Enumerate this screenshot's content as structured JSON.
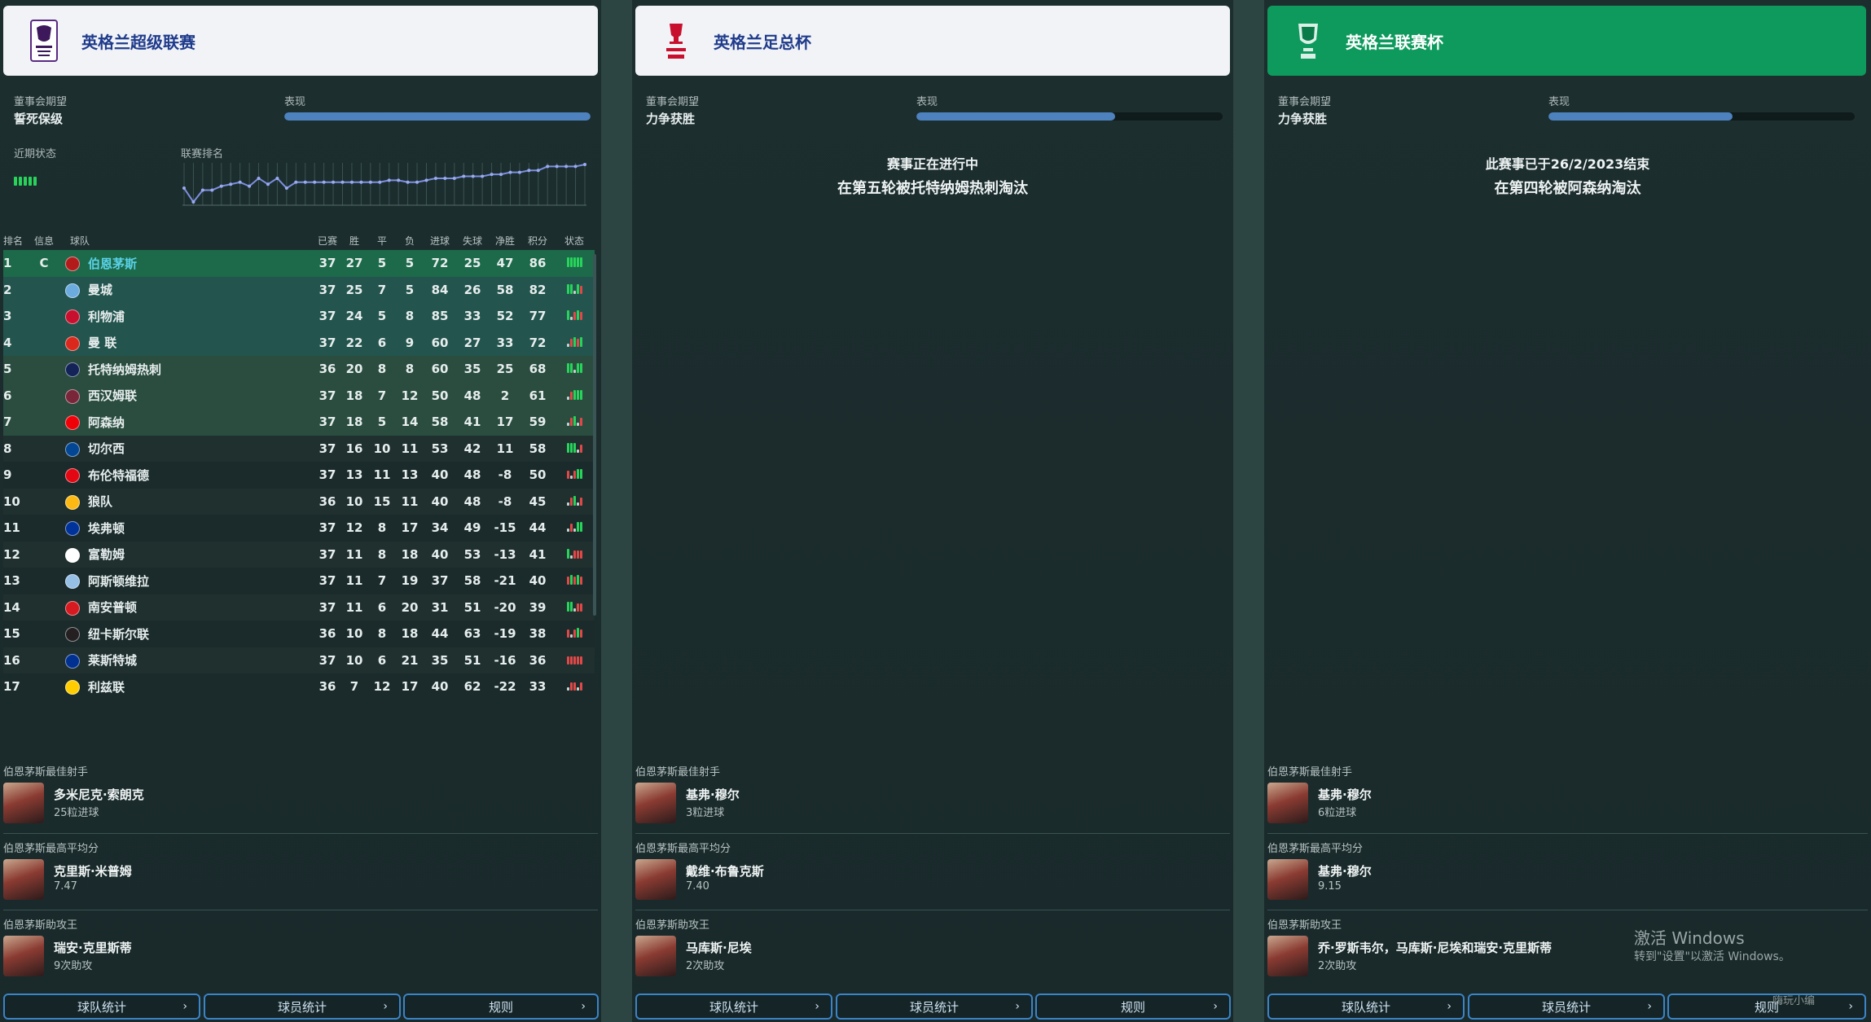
{
  "panels": [
    {
      "title": "英格兰超级联赛",
      "board_label": "董事会期望",
      "board_value": "誓死保级",
      "perf_label": "表现",
      "perf_fill": 1.0,
      "recent_label": "近期状态",
      "rank_label": "联赛排名"
    },
    {
      "title": "英格兰足总杯",
      "board_label": "董事会期望",
      "board_value": "力争获胜",
      "perf_label": "表现",
      "perf_fill": 0.65,
      "status_line1": "赛事正在进行中",
      "status_line2": "在第五轮被托特纳姆热刺淘汰"
    },
    {
      "title": "英格兰联赛杯",
      "board_label": "董事会期望",
      "board_value": "力争获胜",
      "perf_label": "表现",
      "perf_fill": 0.6,
      "status_line1": "此赛事已于26/2/2023结束",
      "status_line2": "在第四轮被阿森纳淘汰"
    }
  ],
  "table_headers": [
    "排名",
    "信息",
    "球队",
    "已赛",
    "胜",
    "平",
    "负",
    "进球",
    "失球",
    "净胜",
    "积分",
    "状态"
  ],
  "rows": [
    {
      "pos": "1",
      "info": "C",
      "team": "伯恩茅斯",
      "p": "37",
      "w": "27",
      "d": "5",
      "l": "5",
      "gf": "72",
      "ga": "25",
      "gd": "47",
      "pts": "86",
      "crest": "#b31b1b",
      "form": "WWWWW"
    },
    {
      "pos": "2",
      "info": "",
      "team": "曼城",
      "p": "37",
      "w": "25",
      "d": "7",
      "l": "5",
      "gf": "84",
      "ga": "26",
      "gd": "58",
      "pts": "82",
      "crest": "#6cabdd",
      "form": "WWDWL"
    },
    {
      "pos": "3",
      "info": "",
      "team": "利物浦",
      "p": "37",
      "w": "24",
      "d": "5",
      "l": "8",
      "gf": "85",
      "ga": "33",
      "gd": "52",
      "pts": "77",
      "crest": "#c8102e",
      "form": "WDLWL"
    },
    {
      "pos": "4",
      "info": "",
      "team": "曼 联",
      "p": "37",
      "w": "22",
      "d": "6",
      "l": "9",
      "gf": "60",
      "ga": "27",
      "gd": "33",
      "pts": "72",
      "crest": "#da291c",
      "form": "DLWLW"
    },
    {
      "pos": "5",
      "info": "",
      "team": "托特纳姆热刺",
      "p": "36",
      "w": "20",
      "d": "8",
      "l": "8",
      "gf": "60",
      "ga": "35",
      "gd": "25",
      "pts": "68",
      "crest": "#132257",
      "form": "WWDWW"
    },
    {
      "pos": "6",
      "info": "",
      "team": "西汉姆联",
      "p": "37",
      "w": "18",
      "d": "7",
      "l": "12",
      "gf": "50",
      "ga": "48",
      "gd": "2",
      "pts": "61",
      "crest": "#7a263a",
      "form": "DLWWW"
    },
    {
      "pos": "7",
      "info": "",
      "team": "阿森纳",
      "p": "37",
      "w": "18",
      "d": "5",
      "l": "14",
      "gf": "58",
      "ga": "41",
      "gd": "17",
      "pts": "59",
      "crest": "#ef0107",
      "form": "DLWDL"
    },
    {
      "pos": "8",
      "info": "",
      "team": "切尔西",
      "p": "37",
      "w": "16",
      "d": "10",
      "l": "11",
      "gf": "53",
      "ga": "42",
      "gd": "11",
      "pts": "58",
      "crest": "#034694",
      "form": "WWWDL"
    },
    {
      "pos": "9",
      "info": "",
      "team": "布伦特福德",
      "p": "37",
      "w": "13",
      "d": "11",
      "l": "13",
      "gf": "40",
      "ga": "48",
      "gd": "-8",
      "pts": "50",
      "crest": "#e30613",
      "form": "LDLWW"
    },
    {
      "pos": "10",
      "info": "",
      "team": "狼队",
      "p": "36",
      "w": "10",
      "d": "15",
      "l": "11",
      "gf": "40",
      "ga": "48",
      "gd": "-8",
      "pts": "45",
      "crest": "#fdb913",
      "form": "DLWDL"
    },
    {
      "pos": "11",
      "info": "",
      "team": "埃弗顿",
      "p": "37",
      "w": "12",
      "d": "8",
      "l": "17",
      "gf": "34",
      "ga": "49",
      "gd": "-15",
      "pts": "44",
      "crest": "#003399",
      "form": "DLDWW"
    },
    {
      "pos": "12",
      "info": "",
      "team": "富勒姆",
      "p": "37",
      "w": "11",
      "d": "8",
      "l": "18",
      "gf": "40",
      "ga": "53",
      "gd": "-13",
      "pts": "41",
      "crest": "#ffffff",
      "form": "WDLLL"
    },
    {
      "pos": "13",
      "info": "",
      "team": "阿斯顿维拉",
      "p": "37",
      "w": "11",
      "d": "7",
      "l": "19",
      "gf": "37",
      "ga": "58",
      "gd": "-21",
      "pts": "40",
      "crest": "#95bfe5",
      "form": "LWLWL"
    },
    {
      "pos": "14",
      "info": "",
      "team": "南安普顿",
      "p": "37",
      "w": "11",
      "d": "6",
      "l": "20",
      "gf": "31",
      "ga": "51",
      "gd": "-20",
      "pts": "39",
      "crest": "#d71920",
      "form": "WWDLL"
    },
    {
      "pos": "15",
      "info": "",
      "team": "纽卡斯尔联",
      "p": "36",
      "w": "10",
      "d": "8",
      "l": "18",
      "gf": "44",
      "ga": "63",
      "gd": "-19",
      "pts": "38",
      "crest": "#241f20",
      "form": "LDLWL"
    },
    {
      "pos": "16",
      "info": "",
      "team": "莱斯特城",
      "p": "37",
      "w": "10",
      "d": "6",
      "l": "21",
      "gf": "35",
      "ga": "51",
      "gd": "-16",
      "pts": "36",
      "crest": "#003090",
      "form": "LLLLL"
    },
    {
      "pos": "17",
      "info": "",
      "team": "利兹联",
      "p": "36",
      "w": "7",
      "d": "12",
      "l": "17",
      "gf": "40",
      "ga": "62",
      "gd": "-22",
      "pts": "33",
      "crest": "#ffcd00",
      "form": "DLLDL"
    }
  ],
  "rank_history": [
    13,
    20,
    14,
    14,
    12,
    11,
    10,
    12,
    8,
    11,
    8,
    13,
    10,
    10,
    10,
    10,
    10,
    10,
    10,
    10,
    10,
    10,
    9,
    9,
    10,
    10,
    9,
    8,
    8,
    8,
    7,
    7,
    7,
    6,
    6,
    5,
    5,
    4,
    4,
    2,
    2,
    2,
    2,
    1
  ],
  "recent_form": "WWWWW",
  "stats": [
    [
      {
        "label": "伯恩茅斯最佳射手",
        "name": "多米尼克·索朗克",
        "sub": "25粒进球"
      },
      {
        "label": "伯恩茅斯最高平均分",
        "name": "克里斯·米普姆",
        "sub": "7.47"
      },
      {
        "label": "伯恩茅斯助攻王",
        "name": "瑞安·克里斯蒂",
        "sub": "9次助攻"
      }
    ],
    [
      {
        "label": "伯恩茅斯最佳射手",
        "name": "基弗·穆尔",
        "sub": "3粒进球"
      },
      {
        "label": "伯恩茅斯最高平均分",
        "name": "戴维·布鲁克斯",
        "sub": "7.40"
      },
      {
        "label": "伯恩茅斯助攻王",
        "name": "马库斯·尼埃",
        "sub": "2次助攻"
      }
    ],
    [
      {
        "label": "伯恩茅斯最佳射手",
        "name": "基弗·穆尔",
        "sub": "6粒进球"
      },
      {
        "label": "伯恩茅斯最高平均分",
        "name": "基弗·穆尔",
        "sub": "9.15"
      },
      {
        "label": "伯恩茅斯助攻王",
        "name": "乔·罗斯韦尔，马库斯·尼埃和瑞安·克里斯蒂",
        "sub": "2次助攻"
      }
    ]
  ],
  "buttons": [
    "球队统计",
    "球员统计",
    "规则"
  ],
  "watermark": {
    "line1": "激活 Windows",
    "line2": "转到\"设置\"以激活 Windows。"
  },
  "corner_text": "嗨玩小编",
  "colors": {
    "win": "#27d35a",
    "draw": "#c9d0d0",
    "loss": "#e04848",
    "accent": "#4d82bf",
    "cup_header": "#0d9a5c"
  }
}
